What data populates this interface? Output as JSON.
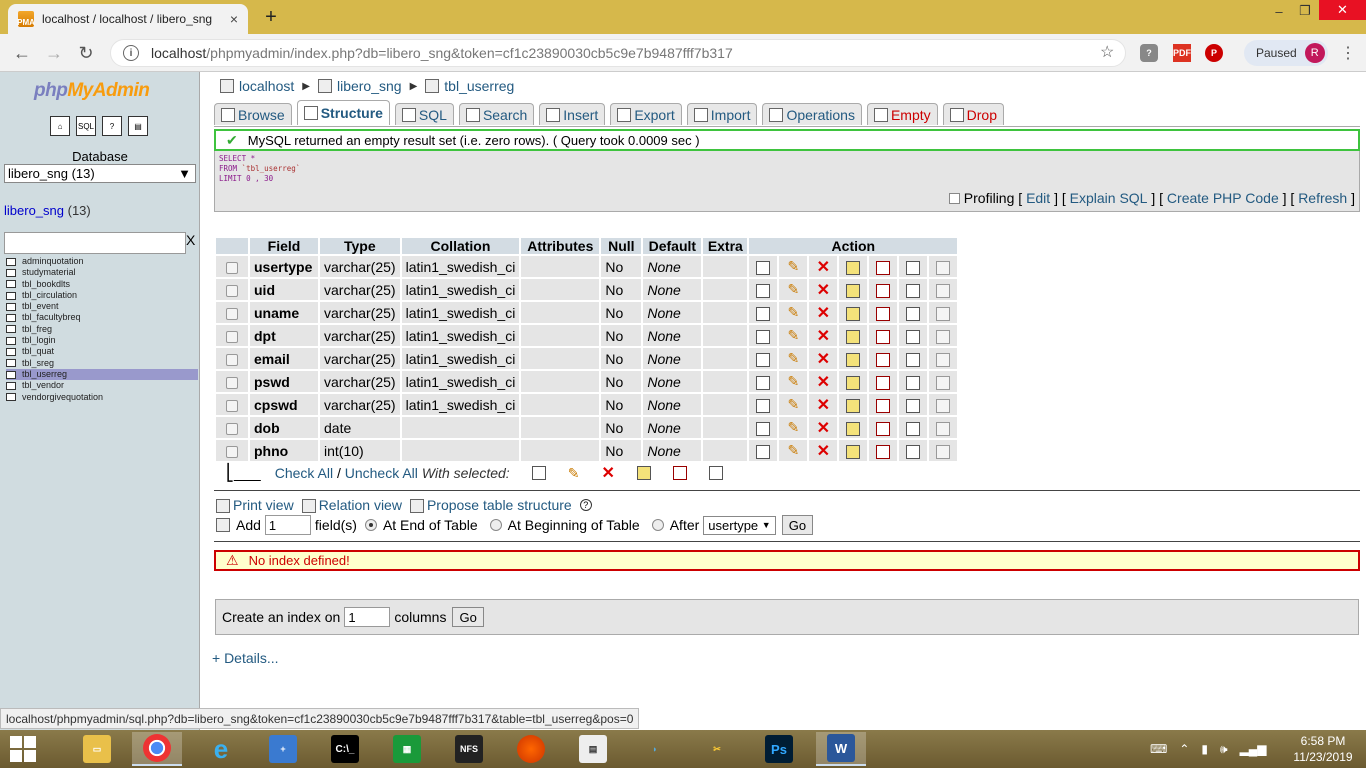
{
  "browser": {
    "tab_title": "localhost / localhost / libero_sng",
    "tab_close": "×",
    "new_tab": "+",
    "url_host": "localhost",
    "url_rest": "/phpmyadmin/index.php?db=libero_sng&token=cf1c23890030cb5c9e7b9487fff7b317",
    "profile_status": "Paused",
    "profile_initial": "R",
    "minimize": "–",
    "restore": "❐",
    "close": "✕"
  },
  "nav": {
    "logo_php": "php",
    "logo_my": "MyAdmin",
    "database_label": "Database",
    "database_select": "libero_sng (13)",
    "db_title": "libero_sng",
    "db_count": "(13)",
    "filter_clear": "X",
    "tables": [
      "adminquotation",
      "studymaterial",
      "tbl_bookdlts",
      "tbl_circulation",
      "tbl_event",
      "tbl_facultybreq",
      "tbl_freg",
      "tbl_login",
      "tbl_quat",
      "tbl_sreg",
      "tbl_userreg",
      "tbl_vendor",
      "vendorgivequotation"
    ],
    "selected_table": "tbl_userreg"
  },
  "breadcrumb": {
    "server": "localhost",
    "database": "libero_sng",
    "table": "tbl_userreg"
  },
  "tabs": [
    "Browse",
    "Structure",
    "SQL",
    "Search",
    "Insert",
    "Export",
    "Import",
    "Operations",
    "Empty",
    "Drop"
  ],
  "active_tab": "Structure",
  "success_message": "MySQL returned an empty result set (i.e. zero rows). ( Query took 0.0009 sec )",
  "sql": {
    "line1": "SELECT *",
    "line2_kw": "FROM",
    "line2_tbl": "`tbl_userreg`",
    "line3": "LIMIT 0 , 30"
  },
  "sql_links": {
    "profiling": "Profiling",
    "edit": "Edit",
    "explain": "Explain SQL",
    "php": "Create PHP Code",
    "refresh": "Refresh"
  },
  "structure": {
    "headers": [
      "Field",
      "Type",
      "Collation",
      "Attributes",
      "Null",
      "Default",
      "Extra",
      "Action"
    ],
    "rows": [
      {
        "field": "usertype",
        "type": "varchar(25)",
        "collation": "latin1_swedish_ci",
        "attributes": "",
        "null": "No",
        "default": "None",
        "extra": ""
      },
      {
        "field": "uid",
        "type": "varchar(25)",
        "collation": "latin1_swedish_ci",
        "attributes": "",
        "null": "No",
        "default": "None",
        "extra": ""
      },
      {
        "field": "uname",
        "type": "varchar(25)",
        "collation": "latin1_swedish_ci",
        "attributes": "",
        "null": "No",
        "default": "None",
        "extra": ""
      },
      {
        "field": "dpt",
        "type": "varchar(25)",
        "collation": "latin1_swedish_ci",
        "attributes": "",
        "null": "No",
        "default": "None",
        "extra": ""
      },
      {
        "field": "email",
        "type": "varchar(25)",
        "collation": "latin1_swedish_ci",
        "attributes": "",
        "null": "No",
        "default": "None",
        "extra": ""
      },
      {
        "field": "pswd",
        "type": "varchar(25)",
        "collation": "latin1_swedish_ci",
        "attributes": "",
        "null": "No",
        "default": "None",
        "extra": ""
      },
      {
        "field": "cpswd",
        "type": "varchar(25)",
        "collation": "latin1_swedish_ci",
        "attributes": "",
        "null": "No",
        "default": "None",
        "extra": ""
      },
      {
        "field": "dob",
        "type": "date",
        "collation": "",
        "attributes": "",
        "null": "No",
        "default": "None",
        "extra": ""
      },
      {
        "field": "phno",
        "type": "int(10)",
        "collation": "",
        "attributes": "",
        "null": "No",
        "default": "None",
        "extra": ""
      }
    ]
  },
  "with_selected": {
    "check_all": "Check All",
    "separator": "/",
    "uncheck_all": "Uncheck All",
    "label": "With selected:"
  },
  "tools": {
    "print_view": "Print view",
    "relation_view": "Relation view",
    "propose": "Propose table structure",
    "help": "?"
  },
  "add_fields": {
    "add_label": "Add",
    "count": "1",
    "fields_label": "field(s)",
    "at_end": "At End of Table",
    "at_beginning": "At Beginning of Table",
    "after": "After",
    "after_select": "usertype",
    "go": "Go"
  },
  "no_index": "No index defined!",
  "create_index": {
    "label": "Create an index on",
    "count": "1",
    "columns_label": "columns",
    "go": "Go"
  },
  "details": "+ Details...",
  "status_url": "localhost/phpmyadmin/sql.php?db=libero_sng&token=cf1c23890030cb5c9e7b9487fff7b317&table=tbl_userreg&pos=0",
  "taskbar": {
    "time": "6:58 PM",
    "date": "11/23/2019"
  }
}
